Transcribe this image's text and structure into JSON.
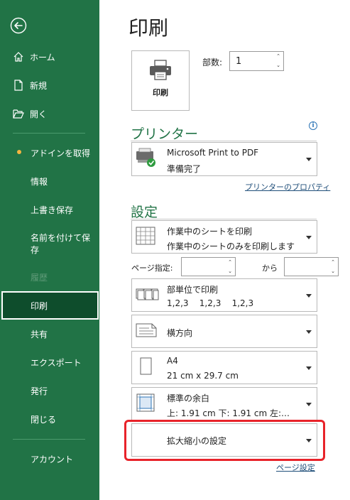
{
  "sidebar": {
    "back_label": "",
    "items": [
      {
        "label": "ホーム"
      },
      {
        "label": "新規"
      },
      {
        "label": "開く"
      },
      {
        "label": "アドインを取得"
      },
      {
        "label": "情報"
      },
      {
        "label": "上書き保存"
      },
      {
        "label": "名前を付けて保存"
      },
      {
        "label": "履歴"
      },
      {
        "label": "印刷"
      },
      {
        "label": "共有"
      },
      {
        "label": "エクスポート"
      },
      {
        "label": "発行"
      },
      {
        "label": "閉じる"
      },
      {
        "label": "アカウント"
      }
    ],
    "active_item": "印刷",
    "accent_dot_color": "#f5b540"
  },
  "main": {
    "title": "印刷",
    "print_button_label": "印刷",
    "copies_label": "部数:",
    "copies_value": "1",
    "printer_heading": "プリンター",
    "printer": {
      "name": "Microsoft Print to PDF",
      "status": "準備完了"
    },
    "printer_properties_link": "プリンターのプロパティ",
    "settings_heading": "設定",
    "settings": {
      "scope": {
        "line1": "作業中のシートを印刷",
        "line2": "作業中のシートのみを印刷します"
      },
      "pages_label": "ページ指定:",
      "pages_to_label": "から",
      "pages_from": "",
      "pages_to": "",
      "collate": {
        "line1": "部単位で印刷",
        "line2": "1,2,3    1,2,3    1,2,3"
      },
      "orientation": {
        "line1": "横方向"
      },
      "paper": {
        "line1": "A4",
        "line2": "21 cm x 29.7 cm"
      },
      "margins": {
        "line1": "標準の余白",
        "line2": "上: 1.91 cm 下: 1.91 cm 左:…"
      },
      "scaling": {
        "line1": "拡大縮小の設定"
      }
    },
    "page_setup_link": "ページ設定"
  },
  "colors": {
    "sidebar_bg": "#217346",
    "active_bg": "#0e4d2c",
    "accent_green": "#217346",
    "highlight_red": "#e8232a"
  }
}
